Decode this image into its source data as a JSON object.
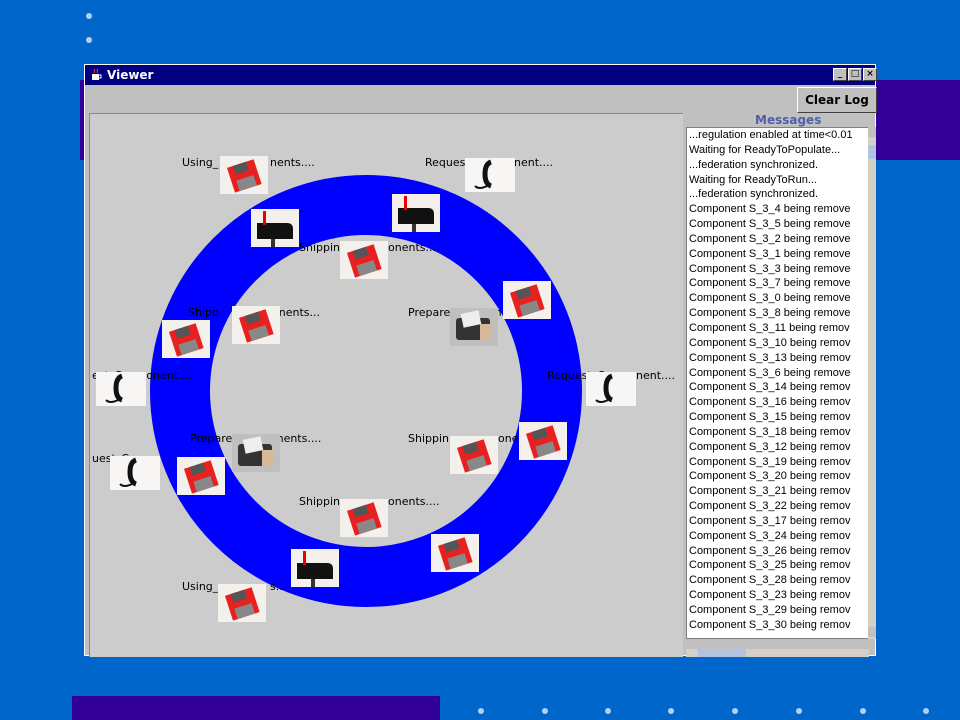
{
  "window": {
    "title": "Viewer",
    "minimize_glyph": "_",
    "maximize_glyph": "□",
    "close_glyph": "×"
  },
  "toolbar": {
    "clear_log_label": "Clear Log"
  },
  "messages": {
    "title": "Messages",
    "lines": [
      "...regulation enabled at time<0.01",
      "Waiting for ReadyToPopulate...",
      "...federation synchronized.",
      "Waiting for ReadyToRun...",
      "...federation synchronized.",
      "Component S_3_4 being remove",
      "Component S_3_5 being remove",
      "Component S_3_2 being remove",
      "Component S_3_1 being remove",
      "Component S_3_3 being remove",
      "Component S_3_7 being remove",
      "Component S_3_0 being remove",
      "Component S_3_8 being remove",
      "Component S_3_11 being remov",
      "Component S_3_10 being remov",
      "Component S_3_13 being remov",
      "Component S_3_6 being remove",
      "Component S_3_14 being remov",
      "Component S_3_16 being remov",
      "Component S_3_15 being remov",
      "Component S_3_18 being remov",
      "Component S_3_12 being remov",
      "Component S_3_19 being remov",
      "Component S_3_20 being remov",
      "Component S_3_21 being remov",
      "Component S_3_22 being remov",
      "Component S_3_17 being remov",
      "Component S_3_24 being remov",
      "Component S_3_26 being remov",
      "Component S_3_25 being remov",
      "Component S_3_28 being remov",
      "Component S_3_23 being remov",
      "Component S_3_29 being remov",
      "Component S_3_30 being remov"
    ]
  },
  "nodes": {
    "using_top": "Using_",
    "using_top_tail": "nents....",
    "request_top_right": "Request_Component....",
    "shipping_top": "Shippin",
    "shipping_top_tail": "onents....",
    "shipping_left": "Shipp",
    "shipping_left_tail": "onents...",
    "prepare_right": "Prepare_Compon",
    "request_left": "est_Component....",
    "request_right": "Request_Component....",
    "prepare_left": "Prepare_Components....",
    "shipping_right": "Shippin",
    "shipping_right_tail": "one",
    "request_left_lower": "uest_Compo",
    "shipping_bottom": "Shippin",
    "shipping_bottom_tail": "onents....",
    "using_bottom": "Using_",
    "using_bottom_tail": "s..."
  },
  "colors": {
    "slide_background": "#0066cc",
    "ring": "#0000ff",
    "canvas": "#cccccc",
    "titlebar": "#000080",
    "accent_band": "#330099",
    "messages_title": "#5060a8"
  },
  "icons": {
    "floppy": "floppy-disk-icon",
    "mailbox": "mailbox-icon",
    "phone": "telephone-icon",
    "card": "card-reader-icon",
    "window": "java-cup-icon"
  }
}
